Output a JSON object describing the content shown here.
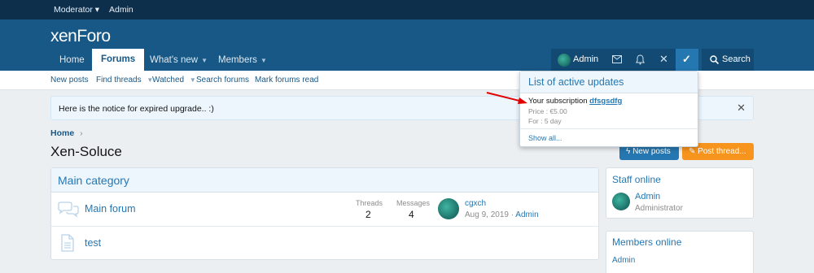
{
  "staff_bar": {
    "moderator": "Moderator",
    "admin": "Admin"
  },
  "logo": "xenForo",
  "nav": {
    "home": "Home",
    "forums": "Forums",
    "whats_new": "What's new",
    "members": "Members"
  },
  "user": {
    "name": "Admin",
    "search": "Search"
  },
  "subnav": {
    "new_posts": "New posts",
    "find_threads": "Find threads",
    "watched": "Watched",
    "search_forums": "Search forums",
    "mark_read": "Mark forums read"
  },
  "notice": {
    "text": "Here is the notice for expired upgrade.. :)"
  },
  "breadcrumb": "Home",
  "page_title": "Xen-Soluce",
  "buttons": {
    "new_posts": "New posts",
    "post_thread": "Post thread..."
  },
  "category": {
    "title": "Main category"
  },
  "forums": [
    {
      "name": "Main forum",
      "threads_label": "Threads",
      "threads": "2",
      "messages_label": "Messages",
      "messages": "4",
      "last_title": "cgxch",
      "last_date": "Aug 9, 2019",
      "last_user": "Admin"
    },
    {
      "name": "test"
    }
  ],
  "staff_online": {
    "title": "Staff online",
    "name": "Admin",
    "role": "Administrator"
  },
  "members_online": {
    "title": "Members online",
    "name": "Admin"
  },
  "popup": {
    "title": "List of active updates",
    "subscription_prefix": "Your subscription",
    "subscription_name": "dfsgsdfg",
    "price": "Price : €5.00",
    "duration": "For : 5 day",
    "show_all": "Show all..."
  },
  "colors": {
    "header": "#185886",
    "staff_bar": "#0e2f4c",
    "accent": "#2577b1",
    "orange": "#f7941d",
    "button_blue": "#2577b1"
  }
}
